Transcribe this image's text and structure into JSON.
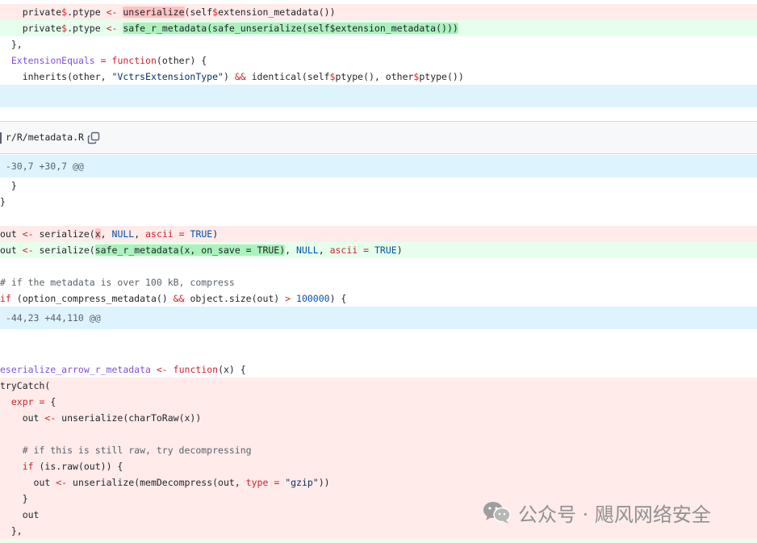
{
  "diff1": {
    "lines": [
      {
        "type": "del",
        "parts": [
          {
            "t": "    private"
          },
          {
            "t": "$",
            "c": "k"
          },
          {
            "t": ".ptype "
          },
          {
            "t": "<-",
            "c": "k"
          },
          {
            "t": " "
          },
          {
            "t": "unserialize",
            "c": "hl"
          },
          {
            "t": "(self"
          },
          {
            "t": "$",
            "c": "k"
          },
          {
            "t": "extension_metadata())"
          }
        ]
      },
      {
        "type": "add",
        "parts": [
          {
            "t": "    private"
          },
          {
            "t": "$",
            "c": "k"
          },
          {
            "t": ".ptype "
          },
          {
            "t": "<-",
            "c": "k"
          },
          {
            "t": " "
          },
          {
            "t": "safe_r_metadata(safe_unserialize(self$extension_metadata()))",
            "c": "hl"
          }
        ]
      },
      {
        "type": "ctx",
        "parts": [
          {
            "t": "  },"
          }
        ]
      },
      {
        "type": "ctx",
        "parts": [
          {
            "t": "  "
          },
          {
            "t": "ExtensionEquals",
            "c": "fn"
          },
          {
            "t": " "
          },
          {
            "t": "=",
            "c": "k"
          },
          {
            "t": " "
          },
          {
            "t": "function",
            "c": "k"
          },
          {
            "t": "(other) {"
          }
        ]
      },
      {
        "type": "ctx",
        "parts": [
          {
            "t": "    inherits(other, "
          },
          {
            "t": "\"VctrsExtensionType\"",
            "c": "s"
          },
          {
            "t": ") "
          },
          {
            "t": "&&",
            "c": "k"
          },
          {
            "t": " identical(self"
          },
          {
            "t": "$",
            "c": "k"
          },
          {
            "t": "ptype(), other"
          },
          {
            "t": "$",
            "c": "k"
          },
          {
            "t": "ptype())"
          }
        ]
      }
    ]
  },
  "file_header": {
    "path": "r/R/metadata.R",
    "copy_icon": "copy-icon"
  },
  "hunks": [
    {
      "header": " -30,7 +30,7 @@"
    },
    {
      "header": " -44,23 +44,110 @@"
    }
  ],
  "diff2": {
    "lines": [
      {
        "type": "ctx",
        "parts": [
          {
            "t": "  }"
          }
        ]
      },
      {
        "type": "ctx",
        "parts": [
          {
            "t": "}"
          }
        ]
      },
      {
        "type": "ctx",
        "parts": [
          {
            "t": ""
          }
        ]
      },
      {
        "type": "del",
        "parts": [
          {
            "t": "out "
          },
          {
            "t": "<-",
            "c": "k"
          },
          {
            "t": " serialize("
          },
          {
            "t": "x",
            "c": "hl"
          },
          {
            "t": ", "
          },
          {
            "t": "NULL",
            "c": "n"
          },
          {
            "t": ", "
          },
          {
            "t": "ascii",
            "c": "k"
          },
          {
            "t": " "
          },
          {
            "t": "=",
            "c": "k"
          },
          {
            "t": " "
          },
          {
            "t": "TRUE",
            "c": "n"
          },
          {
            "t": ")"
          }
        ]
      },
      {
        "type": "add",
        "parts": [
          {
            "t": "out "
          },
          {
            "t": "<-",
            "c": "k"
          },
          {
            "t": " serialize("
          },
          {
            "t": "safe_r_metadata(x, on_save = TRUE)",
            "c": "hl"
          },
          {
            "t": ", "
          },
          {
            "t": "NULL",
            "c": "n"
          },
          {
            "t": ", "
          },
          {
            "t": "ascii",
            "c": "k"
          },
          {
            "t": " "
          },
          {
            "t": "=",
            "c": "k"
          },
          {
            "t": " "
          },
          {
            "t": "TRUE",
            "c": "n"
          },
          {
            "t": ")"
          }
        ]
      },
      {
        "type": "ctx",
        "parts": [
          {
            "t": ""
          }
        ]
      },
      {
        "type": "ctx",
        "parts": [
          {
            "t": "# if the metadata is over 100 kB, compress",
            "c": "c"
          }
        ]
      },
      {
        "type": "ctx",
        "parts": [
          {
            "t": "if",
            "c": "k"
          },
          {
            "t": " (option_compress_metadata() "
          },
          {
            "t": "&&",
            "c": "k"
          },
          {
            "t": " object.size(out) "
          },
          {
            "t": ">",
            "c": "k"
          },
          {
            "t": " "
          },
          {
            "t": "100000",
            "c": "n"
          },
          {
            "t": ") {"
          }
        ]
      }
    ]
  },
  "diff3": {
    "lines": [
      {
        "type": "ctx",
        "parts": [
          {
            "t": ""
          }
        ]
      },
      {
        "type": "ctx",
        "parts": [
          {
            "t": ""
          }
        ]
      },
      {
        "type": "ctx",
        "parts": [
          {
            "t": "eserialize_arrow_r_metadata",
            "c": "fn"
          },
          {
            "t": " "
          },
          {
            "t": "<-",
            "c": "k"
          },
          {
            "t": " "
          },
          {
            "t": "function",
            "c": "k"
          },
          {
            "t": "(x) {"
          }
        ]
      },
      {
        "type": "del",
        "parts": [
          {
            "t": "tryCatch("
          }
        ]
      },
      {
        "type": "del",
        "parts": [
          {
            "t": "  "
          },
          {
            "t": "expr",
            "c": "k"
          },
          {
            "t": " "
          },
          {
            "t": "=",
            "c": "k"
          },
          {
            "t": " {"
          }
        ]
      },
      {
        "type": "del",
        "parts": [
          {
            "t": "    out "
          },
          {
            "t": "<-",
            "c": "k"
          },
          {
            "t": " unserialize(charToRaw(x))"
          }
        ]
      },
      {
        "type": "del",
        "parts": [
          {
            "t": ""
          }
        ]
      },
      {
        "type": "del",
        "parts": [
          {
            "t": "    # if this is still raw, try decompressing",
            "c": "c"
          }
        ]
      },
      {
        "type": "del",
        "parts": [
          {
            "t": "    "
          },
          {
            "t": "if",
            "c": "k"
          },
          {
            "t": " (is.raw(out)) {"
          }
        ]
      },
      {
        "type": "del",
        "parts": [
          {
            "t": "      out "
          },
          {
            "t": "<-",
            "c": "k"
          },
          {
            "t": " unserialize(memDecompress(out, "
          },
          {
            "t": "type",
            "c": "k"
          },
          {
            "t": " "
          },
          {
            "t": "=",
            "c": "k"
          },
          {
            "t": " "
          },
          {
            "t": "\"gzip\"",
            "c": "s"
          },
          {
            "t": "))"
          }
        ]
      },
      {
        "type": "del",
        "parts": [
          {
            "t": "    }"
          }
        ]
      },
      {
        "type": "del",
        "parts": [
          {
            "t": "    out"
          }
        ]
      },
      {
        "type": "del",
        "parts": [
          {
            "t": "  },"
          }
        ]
      }
    ]
  },
  "watermark": {
    "text": "公众号 · 飓风网络安全",
    "icon": "wechat-icon"
  }
}
